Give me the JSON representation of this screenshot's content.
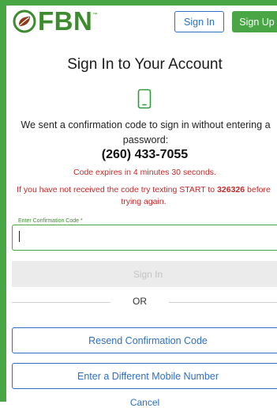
{
  "header": {
    "logo_text": "FBN",
    "logo_tm": "™",
    "signin_label": "Sign In",
    "signup_label": "Sign Up"
  },
  "page": {
    "title": "Sign In to Your Account",
    "message": "We sent a confirmation code to sign in without entering a password:",
    "phone_number": "(260) 433-7055",
    "expires": "Code expires in 4 minutes 30 seconds.",
    "resend_hint_prefix": "If you have not received the code try texting START to ",
    "resend_hint_code": "326326",
    "resend_hint_suffix": " before trying again."
  },
  "form": {
    "code_label": "Enter Confirmation Code *",
    "code_value": "",
    "signin_label": "Sign In",
    "or_label": "OR",
    "resend_label": "Resend Confirmation Code",
    "different_number_label": "Enter a Different Mobile Number",
    "cancel_label": "Cancel"
  },
  "colors": {
    "brand_green": "#49a645",
    "link_blue": "#2f6fc2",
    "error_red": "#c62828"
  },
  "icons": {
    "logo": "fbn-leaf-logo-icon",
    "phone": "mobile-phone-icon"
  }
}
